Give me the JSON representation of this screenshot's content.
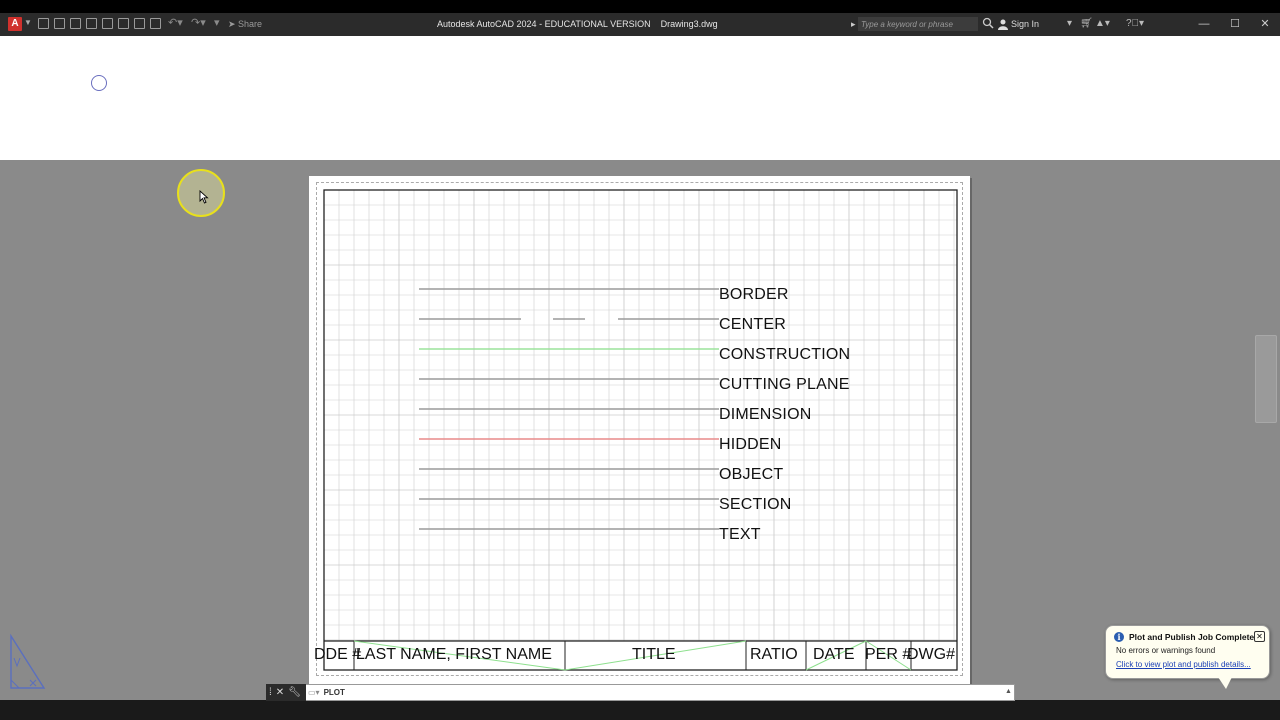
{
  "titlebar": {
    "app_logo": "A",
    "share_label": "Share",
    "window_title": "Autodesk AutoCAD 2024 - EDUCATIONAL VERSION    Drawing3.dwg",
    "search_placeholder": "Type a keyword or phrase",
    "signin_label": "Sign In",
    "icons": [
      "new-icon",
      "open-icon",
      "save-icon",
      "save-as-icon",
      "plot-icon",
      "undo-icon",
      "redo-icon",
      "share-icon",
      "search-icon",
      "user-icon",
      "cart-icon",
      "autodesk-icon",
      "help-icon"
    ]
  },
  "linetype_legend": {
    "items": [
      {
        "label": "BORDER",
        "style": "continuous",
        "color": "#9a9a9a"
      },
      {
        "label": "CENTER",
        "style": "center",
        "color": "#9a9a9a"
      },
      {
        "label": "CONSTRUCTION",
        "style": "continuous",
        "color": "#9be39b"
      },
      {
        "label": "CUTTING PLANE",
        "style": "continuous",
        "color": "#9a9a9a"
      },
      {
        "label": "DIMENSION",
        "style": "continuous",
        "color": "#9a9a9a"
      },
      {
        "label": "HIDDEN",
        "style": "continuous",
        "color": "#e88a8a"
      },
      {
        "label": "OBJECT",
        "style": "continuous",
        "color": "#9a9a9a"
      },
      {
        "label": "SECTION",
        "style": "continuous",
        "color": "#9a9a9a"
      },
      {
        "label": "TEXT",
        "style": "continuous",
        "color": "#9a9a9a"
      }
    ]
  },
  "title_block": {
    "cells": [
      "DDE #",
      "LAST NAME, FIRST NAME",
      "TITLE",
      "RATIO",
      "DATE",
      "PER #",
      "DWG#"
    ]
  },
  "command_line": {
    "prompt": "PLOT"
  },
  "notification": {
    "title": "Plot and Publish Job Complete",
    "message": "No errors or warnings found",
    "link": "Click to view plot and publish details..."
  },
  "colors": {
    "grid": "#cfcfcf",
    "grid_major": "#b5b5b5",
    "construction": "#9be39b",
    "hidden": "#e88a8a",
    "cursor_highlight": "#e8e01c"
  }
}
